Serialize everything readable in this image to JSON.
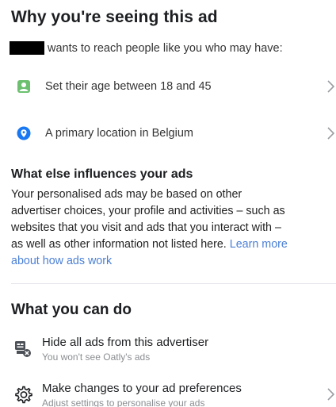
{
  "header": {
    "title": "Why you're seeing this ad",
    "intro_text": "wants to reach people like you who may have:"
  },
  "criteria": [
    {
      "icon": "person-card-icon",
      "label": "Set their age between 18 and 45"
    },
    {
      "icon": "location-pin-icon",
      "label": "A primary location in Belgium"
    }
  ],
  "influences": {
    "title": "What else influences your ads",
    "lines": [
      "Your personalised ads may be based on other",
      "advertiser choices, your profile and activities – such as",
      "websites that you visit and ads that you interact with –"
    ],
    "line4_text": "as well as other information not listed here. ",
    "link_part1": "Learn more",
    "link_part2": "about how ads work"
  },
  "actions": {
    "title": "What you can do",
    "items": [
      {
        "icon": "hide-ad-icon",
        "title": "Hide all ads from this advertiser",
        "subtitle": "You won't see Oatly's ads"
      },
      {
        "icon": "gear-icon",
        "title": "Make changes to your ad preferences",
        "subtitle": "Adjust settings to personalise your ads"
      }
    ]
  },
  "colors": {
    "link": "#4a7fd6",
    "age_icon": "#6cc070",
    "location_icon": "#1877f2"
  }
}
